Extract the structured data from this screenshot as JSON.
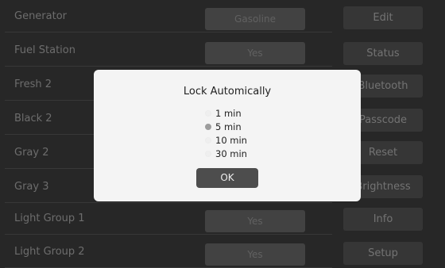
{
  "rows": [
    {
      "label": "Generator",
      "value": "Gasoline"
    },
    {
      "label": "Fuel Station",
      "value": "Yes"
    },
    {
      "label": "Fresh 2",
      "value": ""
    },
    {
      "label": "Black 2",
      "value": ""
    },
    {
      "label": "Gray 2",
      "value": ""
    },
    {
      "label": "Gray 3",
      "value": ""
    },
    {
      "label": "Light Group 1",
      "value": "Yes"
    },
    {
      "label": "Light Group 2",
      "value": "Yes"
    }
  ],
  "side_buttons": [
    "Edit",
    "Status",
    "Bluetooth",
    "Passcode",
    "Reset",
    "Brightness",
    "Info",
    "Setup"
  ],
  "dialog": {
    "title": "Lock Automically",
    "options": [
      "1 min",
      "5 min",
      "10 min",
      "30 min"
    ],
    "selected": "5 min",
    "ok_label": "OK"
  }
}
